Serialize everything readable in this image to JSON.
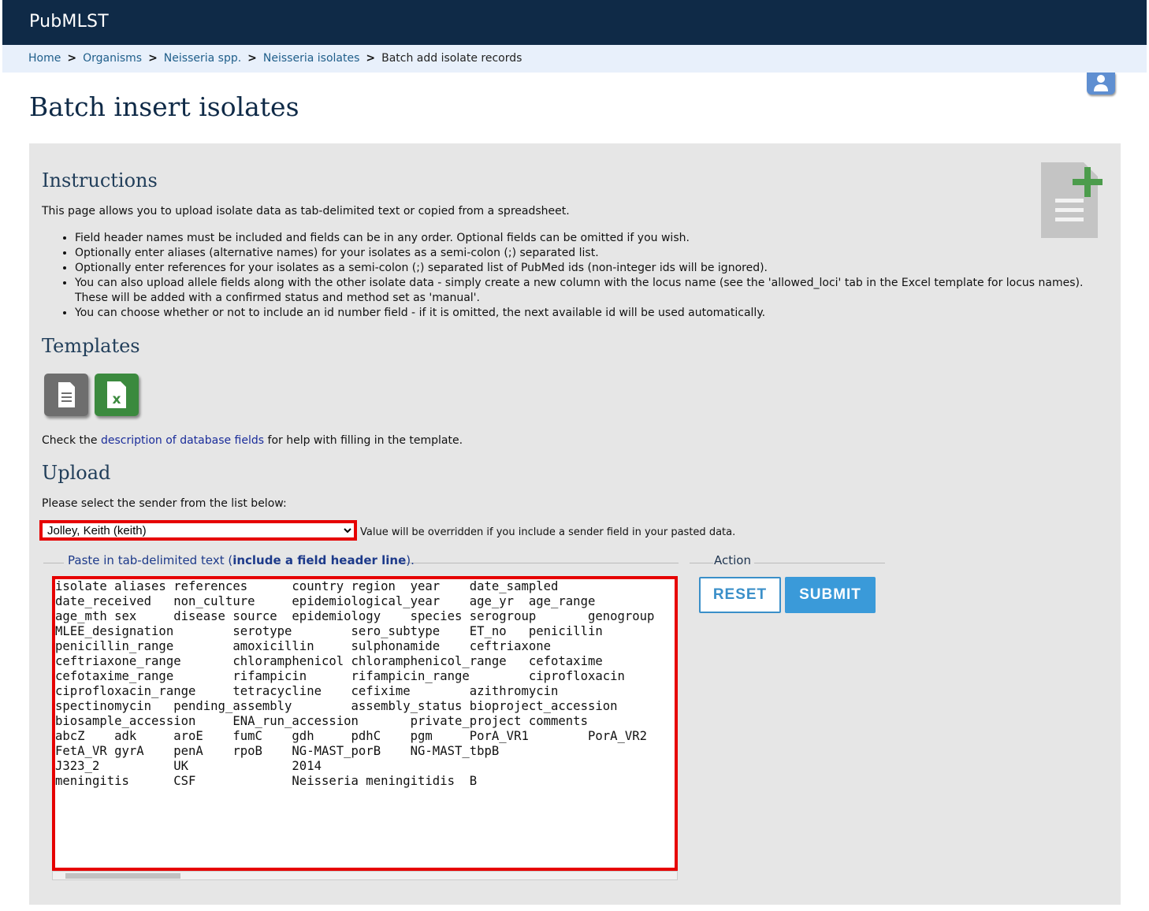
{
  "header": {
    "brand": "PubMLST"
  },
  "breadcrumb": {
    "items": [
      "Home",
      "Organisms",
      "Neisseria spp.",
      "Neisseria isolates"
    ],
    "separator": ">",
    "current": "Batch add isolate records"
  },
  "page": {
    "title": "Batch insert isolates"
  },
  "instructions": {
    "heading": "Instructions",
    "intro": "This page allows you to upload isolate data as tab-delimited text or copied from a spreadsheet.",
    "bullets": [
      "Field header names must be included and fields can be in any order. Optional fields can be omitted if you wish.",
      "Optionally enter aliases (alternative names) for your isolates as a semi-colon (;) separated list.",
      "Optionally enter references for your isolates as a semi-colon (;) separated list of PubMed ids (non-integer ids will be ignored).",
      "You can also upload allele fields along with the other isolate data - simply create a new column with the locus name (see the 'allowed_loci' tab in the Excel template for locus names). These will be added with a confirmed status and method set as 'manual'.",
      "You can choose whether or not to include an id number field - if it is omitted, the next available id will be used automatically."
    ]
  },
  "templates": {
    "heading": "Templates",
    "help_prefix": "Check the ",
    "help_link": "description of database fields",
    "help_suffix": " for help with filling in the template.",
    "xls_glyph": "x"
  },
  "upload": {
    "heading": "Upload",
    "select_prompt": "Please select the sender from the list below:",
    "sender_selected": "Jolley, Keith (keith)",
    "sender_note": "Value will be overridden if you include a sender field in your pasted data.",
    "legend_prefix": "Paste in tab-delimited text (",
    "legend_bold": "include a field header line",
    "legend_suffix": ").",
    "textarea_value": "isolate aliases references      country region  year    date_sampled\ndate_received   non_culture     epidemiological_year    age_yr  age_range\nage_mth sex     disease source  epidemiology    species serogroup       genogroup\nMLEE_designation        serotype        sero_subtype    ET_no   penicillin\npenicillin_range        amoxicillin     sulphonamide    ceftriaxone\nceftriaxone_range       chloramphenicol chloramphenicol_range   cefotaxime\ncefotaxime_range        rifampicin      rifampicin_range        ciprofloxacin\nciprofloxacin_range     tetracycline    cefixime        azithromycin\nspectinomycin   pending_assembly        assembly_status bioproject_accession\nbiosample_accession     ENA_run_accession       private_project comments\nabcZ    adk     aroE    fumC    gdh     pdhC    pgm     PorA_VR1        PorA_VR2\nFetA_VR gyrA    penA    rpoB    NG-MAST_porB    NG-MAST_tbpB\nJ323_2          UK              2014\nmeningitis      CSF             Neisseria meningitidis  B"
  },
  "action": {
    "legend": "Action",
    "reset_label": "RESET",
    "submit_label": "SUBMIT"
  },
  "colors": {
    "header_bg": "#0f2a47",
    "accent": "#3a9ad9",
    "highlight": "#e60000",
    "excel_green": "#3b8a3e"
  }
}
